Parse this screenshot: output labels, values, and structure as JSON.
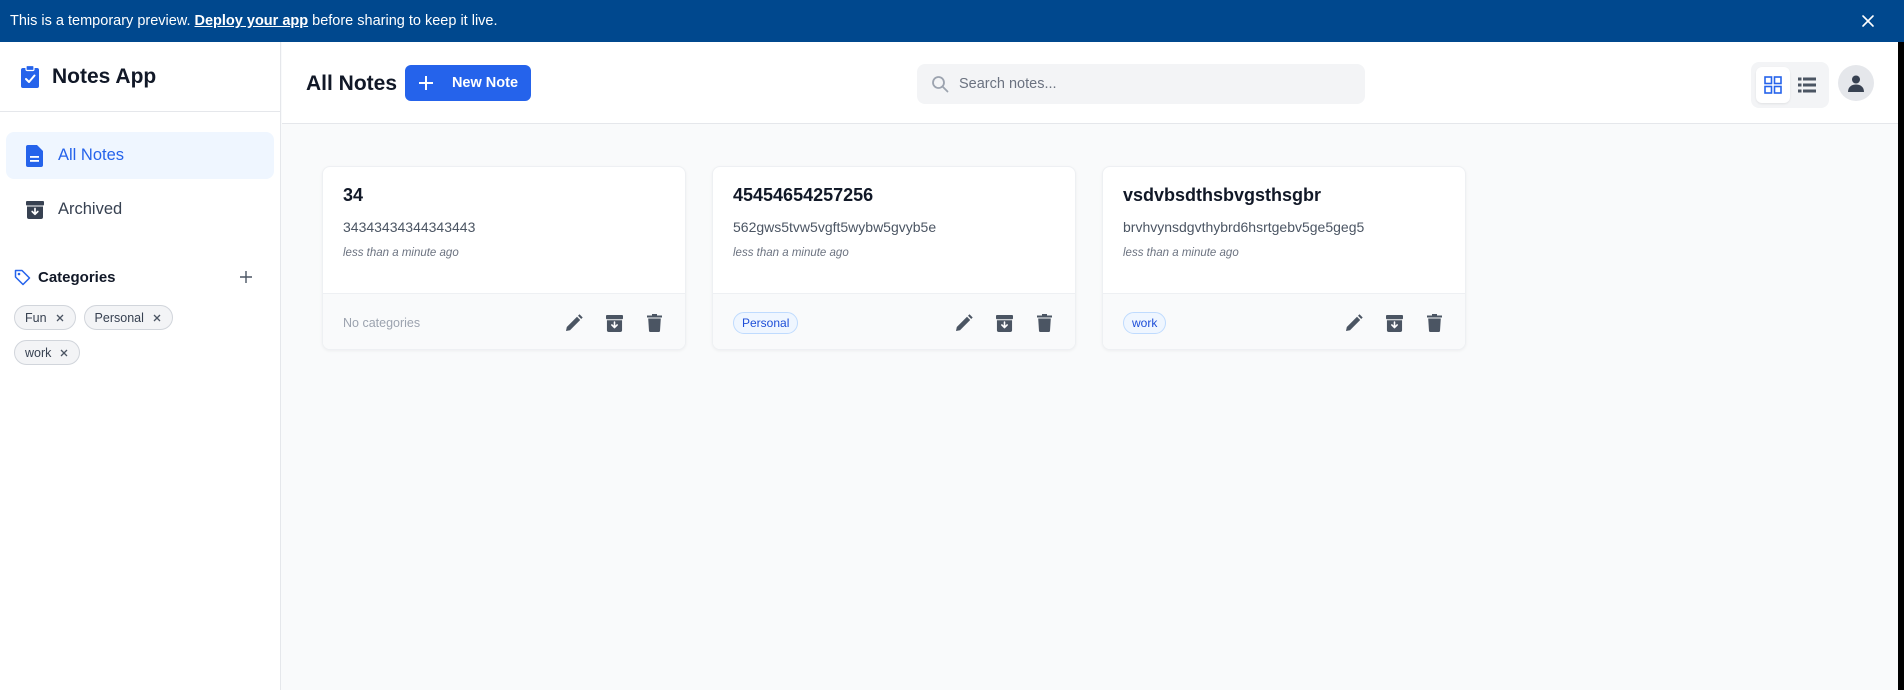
{
  "banner": {
    "text_before": "This is a temporary preview.",
    "link": "Deploy your app",
    "text_after": "before sharing to keep it live.",
    "close_icon": "close-icon"
  },
  "sidebar": {
    "app_title": "Notes App",
    "logo_icon": "clipboard-icon",
    "nav": [
      {
        "label": "All Notes",
        "icon": "document-icon",
        "active": true
      },
      {
        "label": "Archived",
        "icon": "archive-icon",
        "active": false
      }
    ],
    "categories_title": "Categories",
    "categories": [
      "Fun",
      "Personal",
      "work"
    ]
  },
  "header": {
    "title": "All Notes",
    "new_note_label": "New Note",
    "search_placeholder": "Search notes...",
    "view_mode": "grid"
  },
  "notes": [
    {
      "title": "34",
      "content": "34343434344343443",
      "date": "less than a minute ago",
      "category": "",
      "no_category_label": "No categories"
    },
    {
      "title": "45454654257256",
      "content": "562gws5tvw5vgft5wybw5gvyb5e",
      "date": "less than a minute ago",
      "category": "Personal"
    },
    {
      "title": "vsdvbsdthsbvgsthsgbr",
      "content": "brvhvynsdgvthybrd6hsrtgebv5ge5geg5",
      "date": "less than a minute ago",
      "category": "work"
    }
  ],
  "colors": {
    "banner": "#00488e",
    "accent": "#2563eb",
    "background": "#f9fafb"
  }
}
